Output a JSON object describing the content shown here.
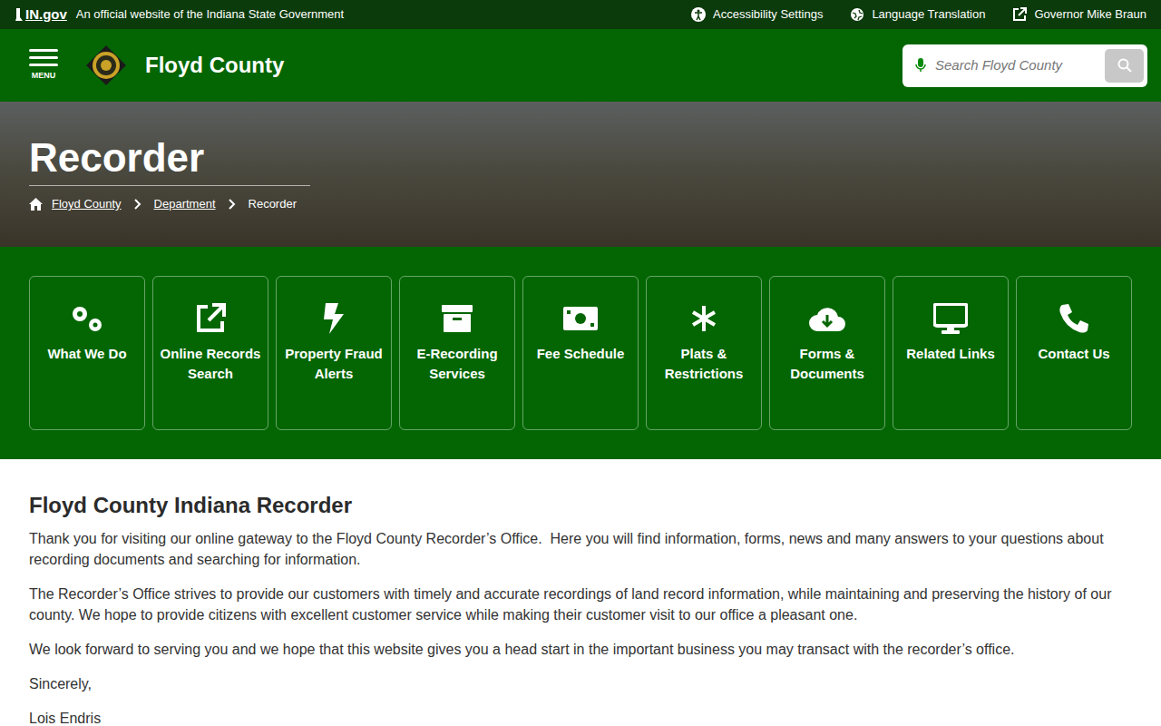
{
  "topbar": {
    "logo": "IN.gov",
    "official": "An official website of the Indiana State Government",
    "links": [
      "Accessibility Settings",
      "Language Translation",
      "Governor Mike Braun"
    ]
  },
  "header": {
    "menu": "MENU",
    "site": "Floyd County",
    "search": {
      "placeholder": "Search Floyd County"
    }
  },
  "hero": {
    "title": "Recorder",
    "breadcrumb": [
      "Floyd County",
      "Department",
      "Recorder"
    ]
  },
  "tiles": [
    "What We Do",
    "Online Records Search",
    "Property Fraud Alerts",
    "E-Recording Services",
    "Fee Schedule",
    "Plats & Restrictions",
    "Forms & Documents",
    "Related Links",
    "Contact Us"
  ],
  "content": {
    "heading": "Floyd County Indiana Recorder",
    "paragraphs": [
      "Thank you for visiting our online gateway to the Floyd County Recorder’s Office.  Here you will find information, forms, news and many answers to your questions about recording documents and searching for information.",
      "The Recorder’s Office strives to provide our customers with timely and accurate recordings of land record information, while maintaining and preserving the history of our county. We hope to provide citizens with excellent customer service while making their customer visit to our office a pleasant one.",
      "We look forward to serving you and we hope that this website gives you a head start in the important business you may transact with the recorder’s office.",
      "Sincerely,",
      "Lois Endris"
    ]
  }
}
